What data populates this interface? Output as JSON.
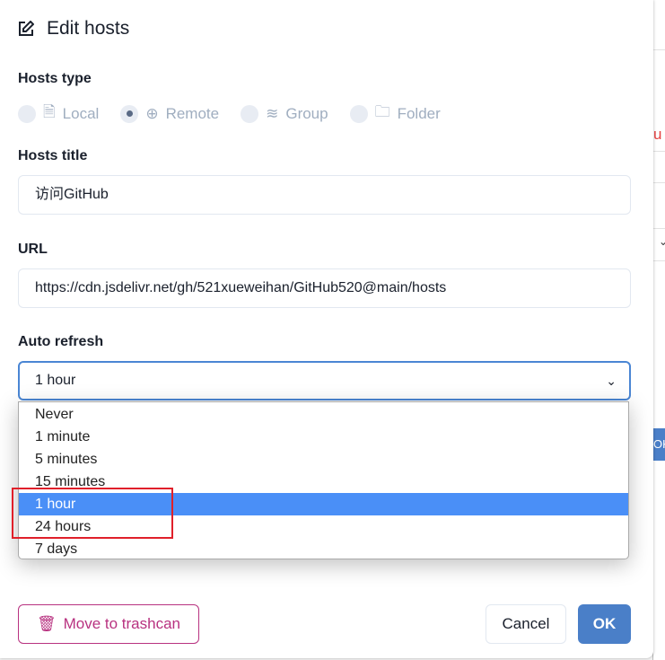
{
  "background": {
    "partial_text": "u",
    "ok_partial": "OK"
  },
  "dialog": {
    "title": "Edit hosts",
    "hosts_type_label": "Hosts type",
    "types": [
      {
        "label": "Local",
        "checked": false
      },
      {
        "label": "Remote",
        "checked": true
      },
      {
        "label": "Group",
        "checked": false
      },
      {
        "label": "Folder",
        "checked": false
      }
    ],
    "hosts_title_label": "Hosts title",
    "hosts_title_value": "访问GitHub",
    "url_label": "URL",
    "url_value": "https://cdn.jsdelivr.net/gh/521xueweihan/GitHub520@main/hosts",
    "auto_refresh_label": "Auto refresh",
    "auto_refresh_value": "1 hour",
    "options": [
      "Never",
      "1 minute",
      "5 minutes",
      "15 minutes",
      "1 hour",
      "24 hours",
      "7 days"
    ],
    "trash_label": "Move to trashcan",
    "cancel_label": "Cancel",
    "ok_label": "OK"
  }
}
